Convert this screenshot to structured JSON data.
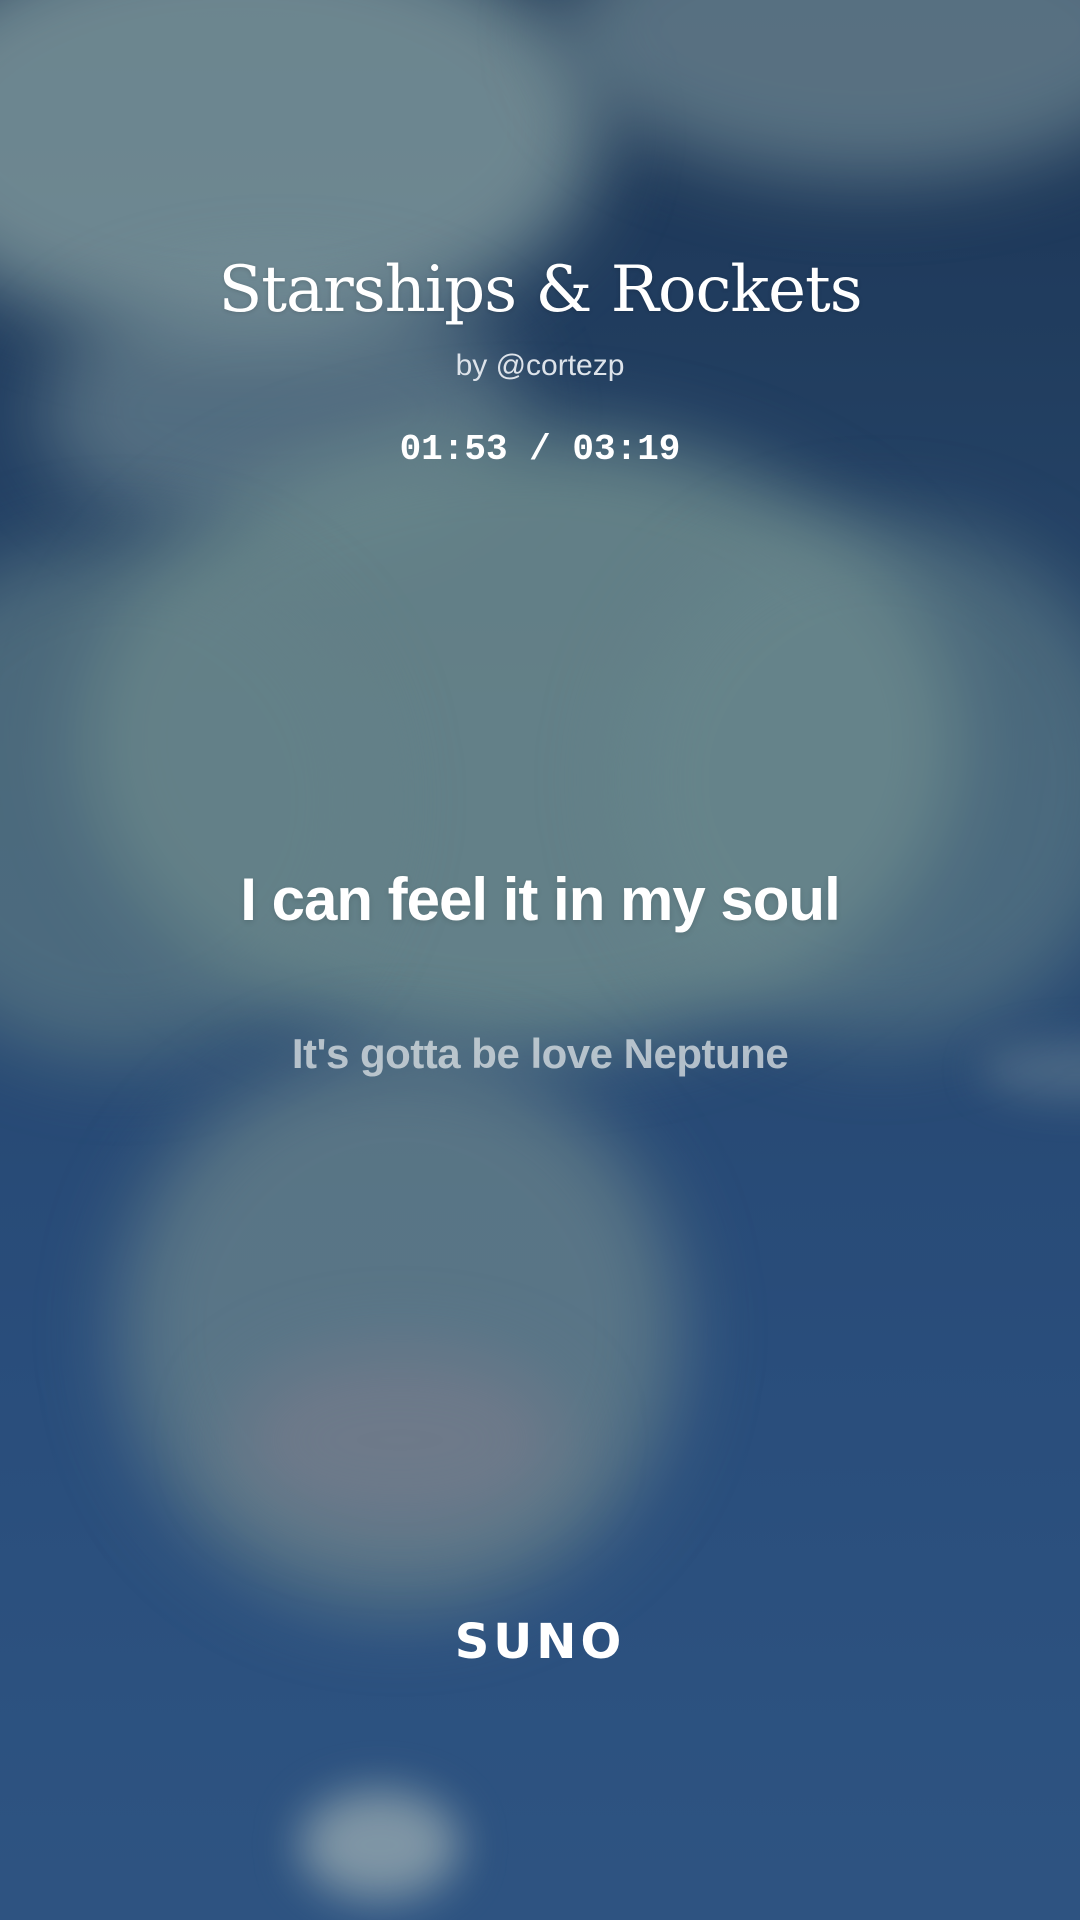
{
  "song": {
    "title": "Starships & Rockets",
    "artist": "by @cortezp"
  },
  "playback": {
    "time": "01:53 / 03:19"
  },
  "lyrics": {
    "current": "I can feel it in my soul",
    "next": "It's gotta be love Neptune"
  },
  "brand": {
    "logo": "SUNO"
  }
}
